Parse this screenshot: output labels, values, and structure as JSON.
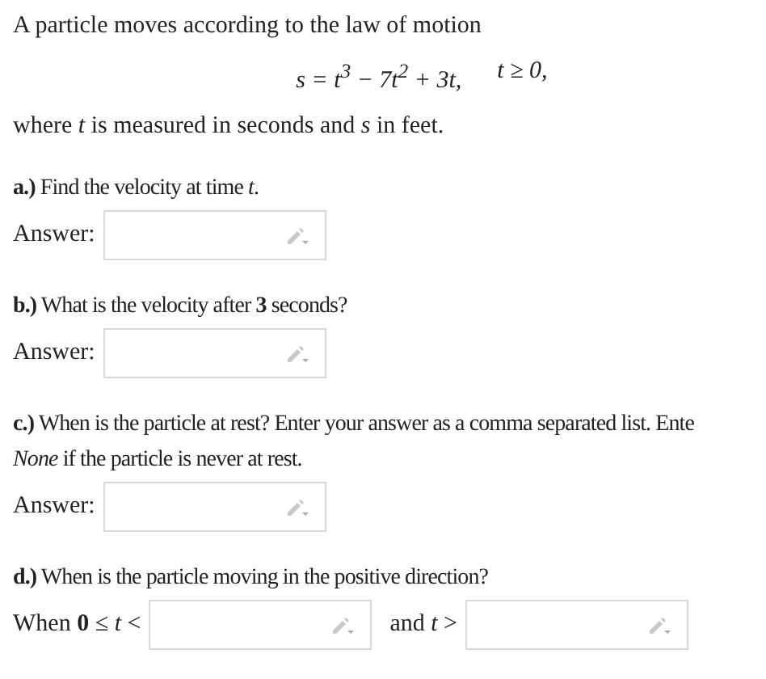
{
  "intro": "A particle moves according to the law of motion",
  "formula": {
    "equation": "s = t$^{3}$ − 7t$^{2}$ + 3t,",
    "condition": "*t* ≥ 0,"
  },
  "note": "where *t* is measured in seconds and *s* in feet.",
  "parts": [
    {
      "lines": [
        "**a.)** Find the velocity at time *t*."
      ],
      "inputs": [
        {
          "prefix": "Answer:"
        }
      ]
    },
    {
      "lines": [
        "**b.)** What is the velocity after **3** seconds?"
      ],
      "inputs": [
        {
          "prefix": "Answer:"
        }
      ]
    },
    {
      "lines": [
        "**c.)** When is the particle at rest? Enter your answer as a comma separated list. Ente",
        "*None* if the particle is never at rest."
      ],
      "inputs": [
        {
          "prefix": "Answer:"
        }
      ]
    },
    {
      "lines": [
        "**d.)** When is the particle moving in the positive direction?"
      ],
      "inputs": [
        {
          "prefix": "When **0** ≤ *t* <"
        },
        {
          "prefix": "and *t* >"
        }
      ]
    }
  ]
}
